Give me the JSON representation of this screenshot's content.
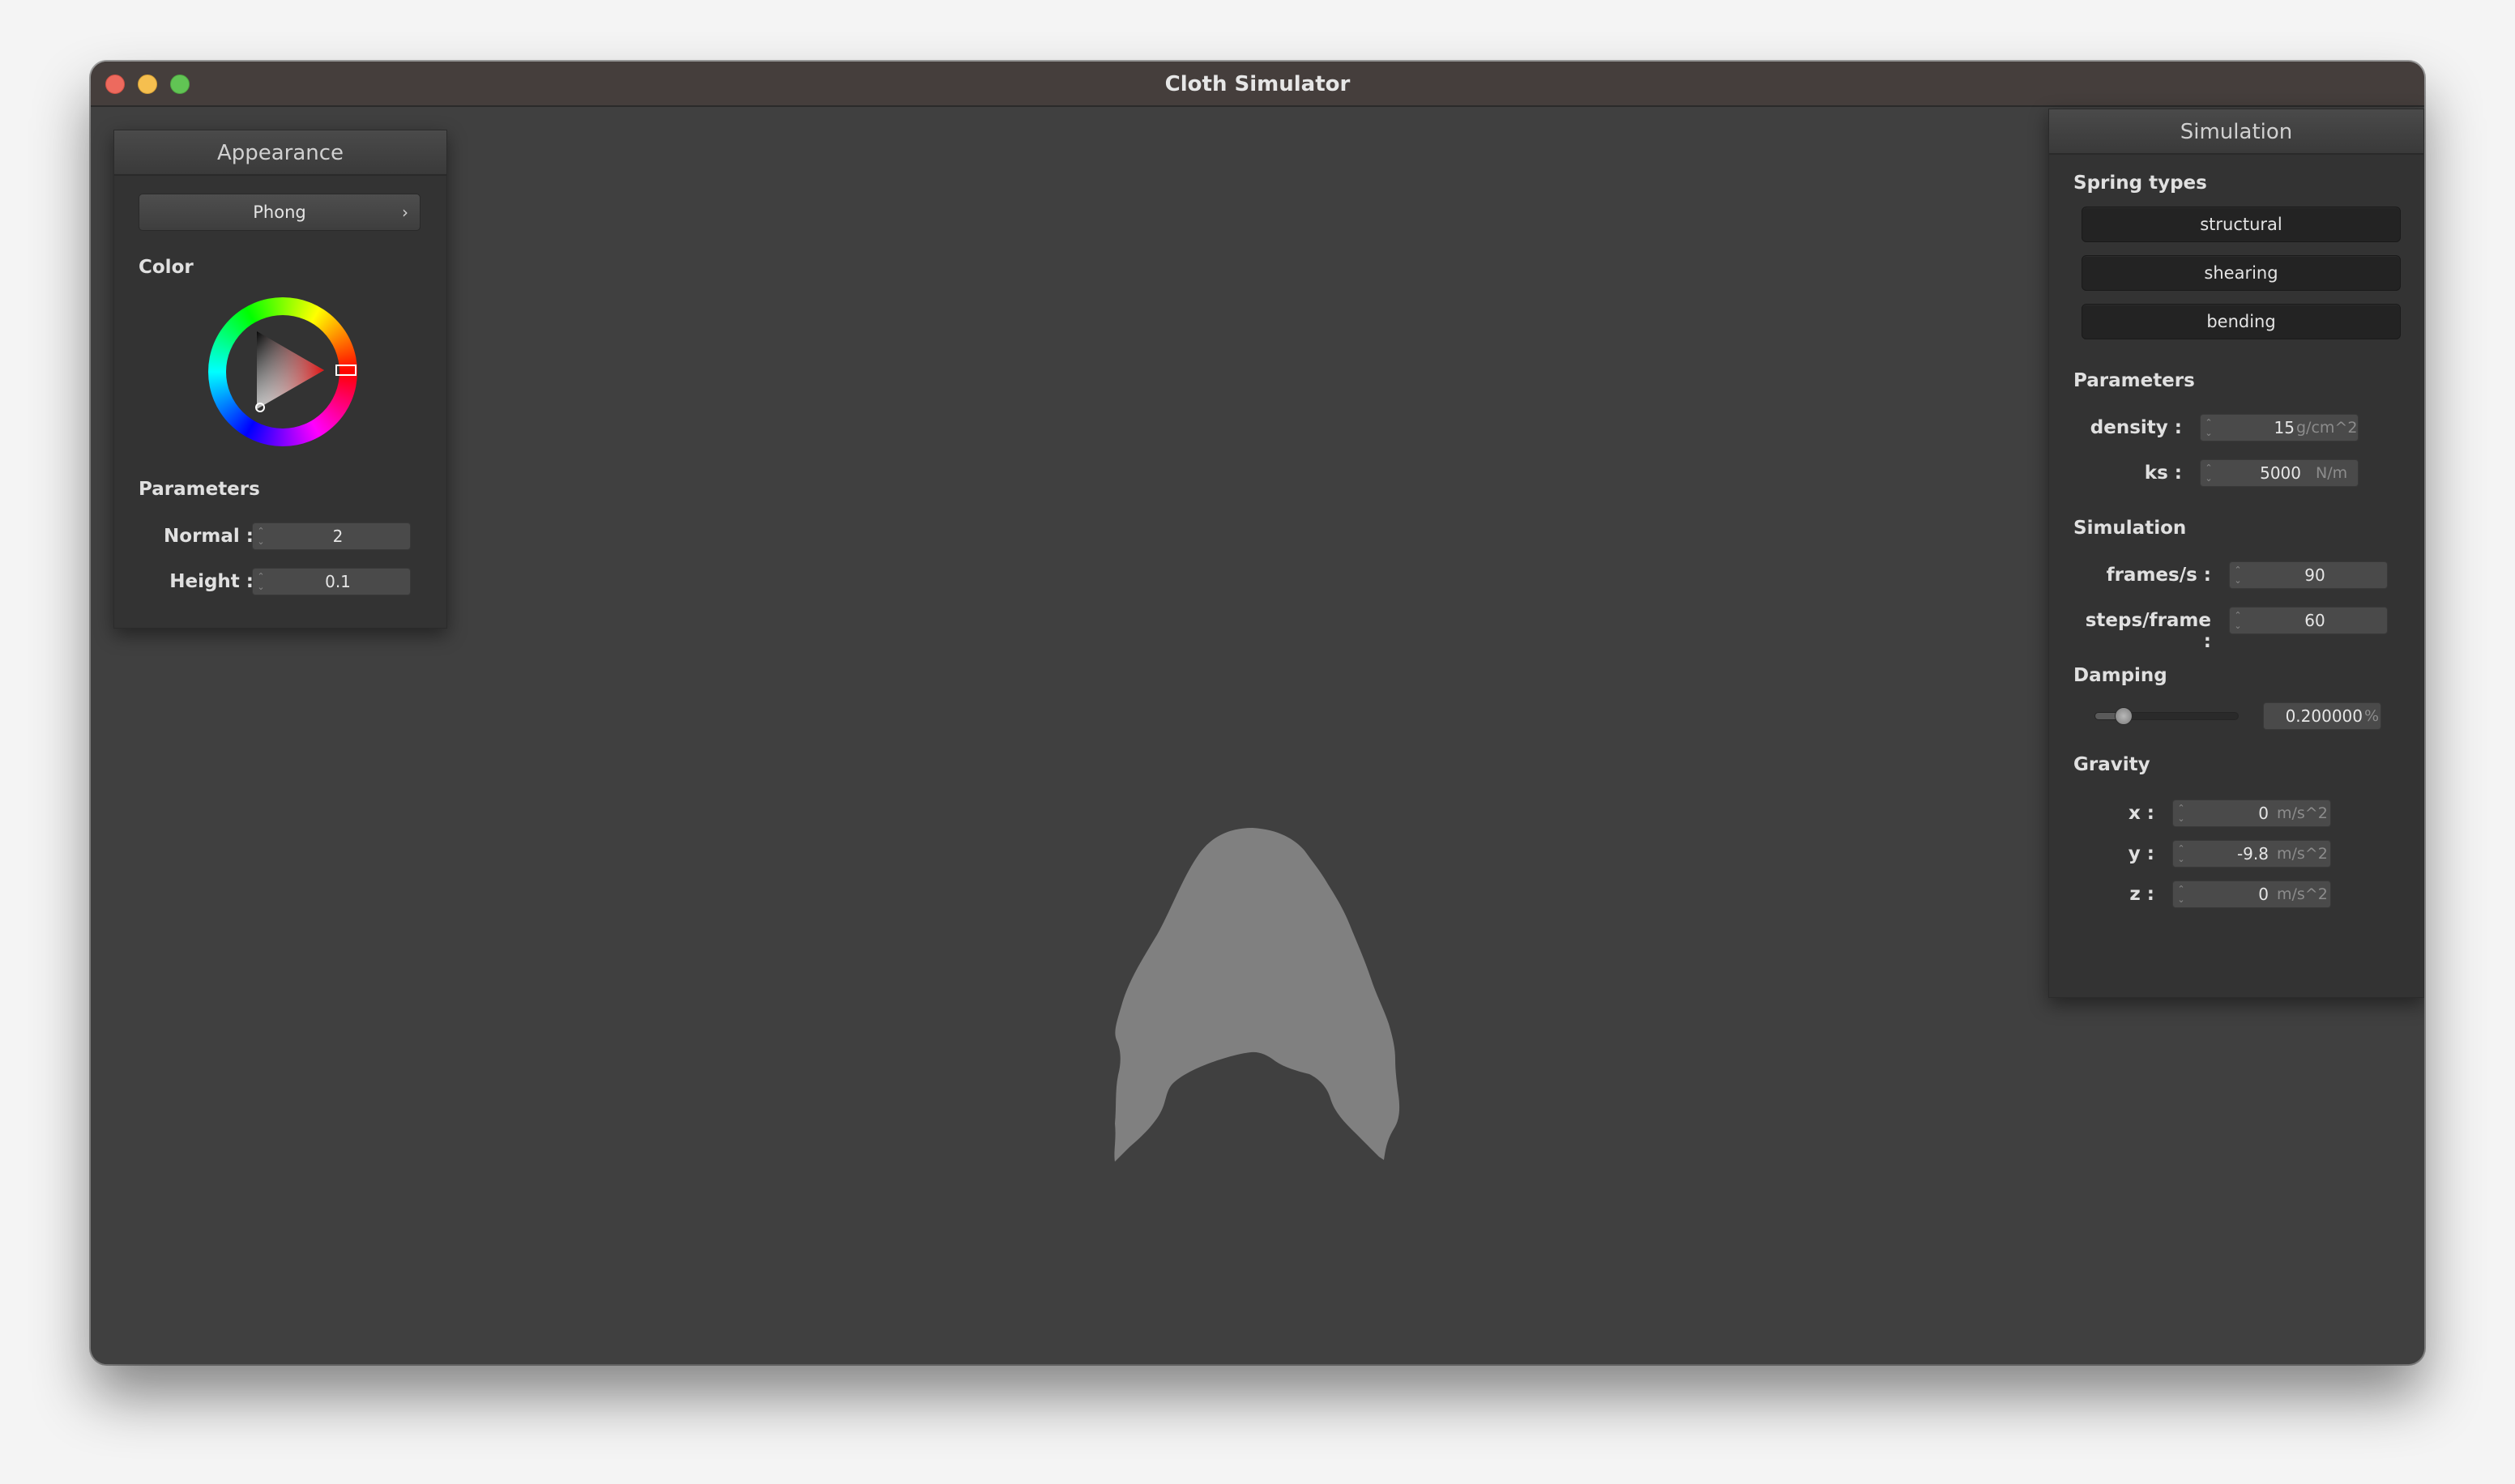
{
  "window": {
    "title": "Cloth Simulator"
  },
  "appearance": {
    "header": "Appearance",
    "shader": "Phong",
    "color_label": "Color",
    "color_value": "#d63a3a",
    "parameters_label": "Parameters",
    "normal_label": "Normal :",
    "normal_value": "2",
    "height_label": "Height :",
    "height_value": "0.1"
  },
  "simulation": {
    "header": "Simulation",
    "spring_types_label": "Spring types",
    "spring_types": [
      "structural",
      "shearing",
      "bending"
    ],
    "parameters_label": "Parameters",
    "density_label": "density :",
    "density_value": "15",
    "density_unit": "g/cm^2",
    "ks_label": "ks :",
    "ks_value": "5000",
    "ks_unit": "N/m",
    "simulation_label": "Simulation",
    "fps_label": "frames/s :",
    "fps_value": "90",
    "steps_label": "steps/frame :",
    "steps_value": "60",
    "damping_label": "Damping",
    "damping_slider_fraction": 0.2,
    "damping_value": "0.200000",
    "damping_unit": "%",
    "gravity_label": "Gravity",
    "gravity": [
      {
        "label": "x :",
        "value": "0",
        "unit": "m/s^2"
      },
      {
        "label": "y :",
        "value": "-9.8",
        "unit": "m/s^2"
      },
      {
        "label": "z :",
        "value": "0",
        "unit": "m/s^2"
      }
    ]
  },
  "colors": {
    "cloth": "#808080",
    "viewport_bg": "#404040"
  }
}
